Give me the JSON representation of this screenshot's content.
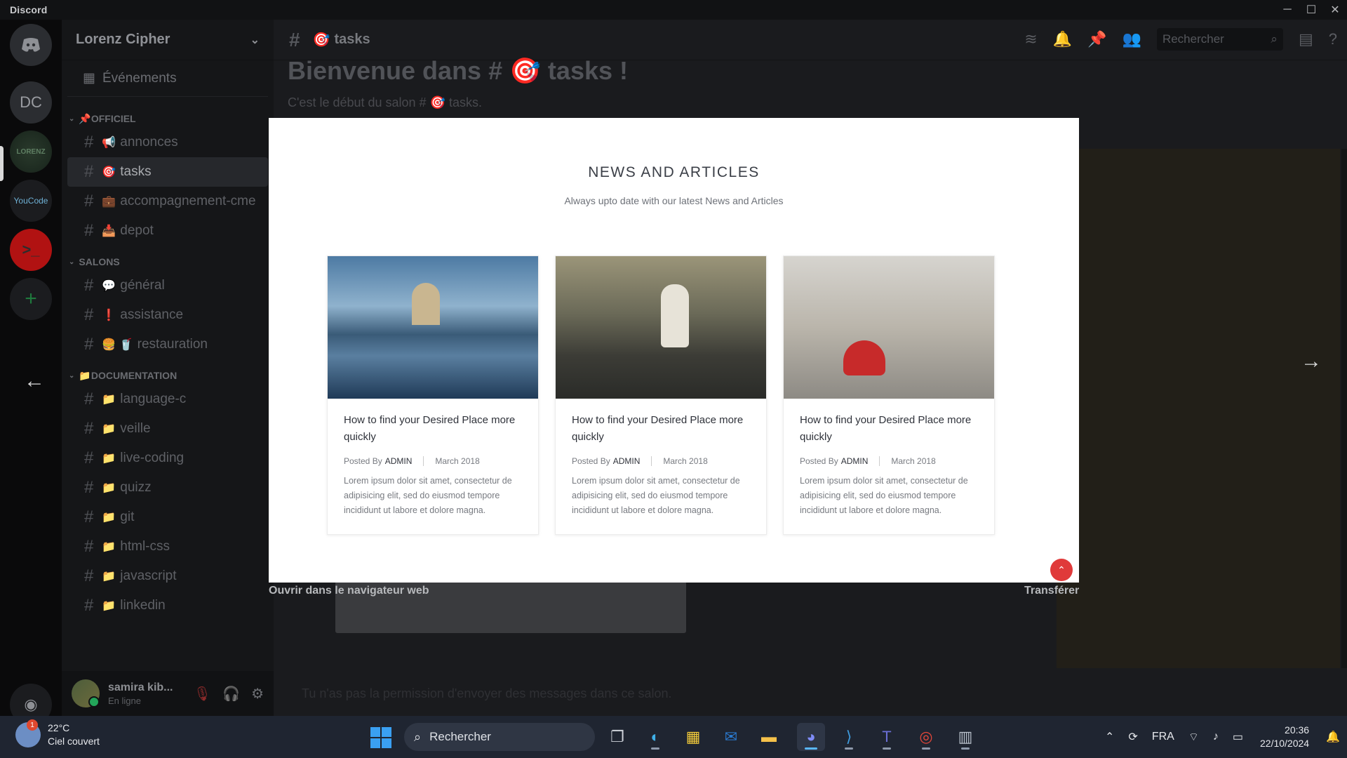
{
  "window": {
    "title": "Discord",
    "controls": [
      "─",
      "☐",
      "✕"
    ]
  },
  "server": {
    "name": "Lorenz Cipher"
  },
  "rail": {
    "dc_label": "DC",
    "lc_label": "LORENZ",
    "yc_label": "YouCode",
    "term_label": ">_",
    "add_label": "+"
  },
  "sidebar": {
    "events_label": "Événements",
    "categories": [
      {
        "name": "OFFICIEL",
        "emoji": "📌"
      },
      {
        "name": "SALONS",
        "emoji": ""
      },
      {
        "name": "DOCUMENTATION",
        "emoji": "📁"
      }
    ],
    "channels_officiel": [
      {
        "emoji": "📢",
        "name": "annonces"
      },
      {
        "emoji": "🎯",
        "name": "tasks"
      },
      {
        "emoji": "💼",
        "name": "accompagnement-cme"
      },
      {
        "emoji": "📥",
        "name": "depot"
      }
    ],
    "channels_salons": [
      {
        "emoji": "💬",
        "name": "général"
      },
      {
        "emoji": "❗",
        "name": "assistance"
      },
      {
        "emoji": "🍔 🥤",
        "name": "restauration"
      }
    ],
    "channels_doc": [
      {
        "emoji": "📁",
        "name": "language-c"
      },
      {
        "emoji": "📁",
        "name": "veille"
      },
      {
        "emoji": "📁",
        "name": "live-coding"
      },
      {
        "emoji": "📁",
        "name": "quizz"
      },
      {
        "emoji": "📁",
        "name": "git"
      },
      {
        "emoji": "📁",
        "name": "html-css"
      },
      {
        "emoji": "📁",
        "name": "javascript"
      },
      {
        "emoji": "📁",
        "name": "linkedin"
      }
    ]
  },
  "user": {
    "name": "samira kib...",
    "status": "En ligne"
  },
  "chat": {
    "channel_emoji": "🎯",
    "channel_name": "tasks",
    "search_placeholder": "Rechercher",
    "welcome_title": "Bienvenue dans # 🎯 tasks !",
    "welcome_sub": "C'est le début du salon # 🎯 tasks.",
    "open_web": "Ouvrir dans le navigateur web",
    "transfer": "Transférer",
    "no_permission": "Tu n'as pas la permission d'envoyer des messages dans ce salon."
  },
  "modal": {
    "title": "NEWS AND ARTICLES",
    "subtitle": "Always upto date with our latest News and Articles",
    "cards": [
      {
        "title": "How to find your Desired Place more quickly",
        "posted_by": "Posted By",
        "author": "ADMIN",
        "date": "March 2018",
        "body": "Lorem ipsum dolor sit amet, consectetur de adipisicing elit, sed do eiusmod tempore incididunt ut labore et dolore magna."
      },
      {
        "title": "How to find your Desired Place more quickly",
        "posted_by": "Posted By",
        "author": "ADMIN",
        "date": "March 2018",
        "body": "Lorem ipsum dolor sit amet, consectetur de adipisicing elit, sed do eiusmod tempore incididunt ut labore et dolore magna."
      },
      {
        "title": "How to find your Desired Place more quickly",
        "posted_by": "Posted By",
        "author": "ADMIN",
        "date": "March 2018",
        "body": "Lorem ipsum dolor sit amet, consectetur de adipisicing elit, sed do eiusmod tempore incididunt ut labore et dolore magna."
      }
    ]
  },
  "taskbar": {
    "weather_temp": "22°C",
    "weather_desc": "Ciel couvert",
    "weather_badge": "1",
    "search_label": "Rechercher",
    "language": "FRA",
    "time": "20:36",
    "date": "22/10/2024"
  }
}
